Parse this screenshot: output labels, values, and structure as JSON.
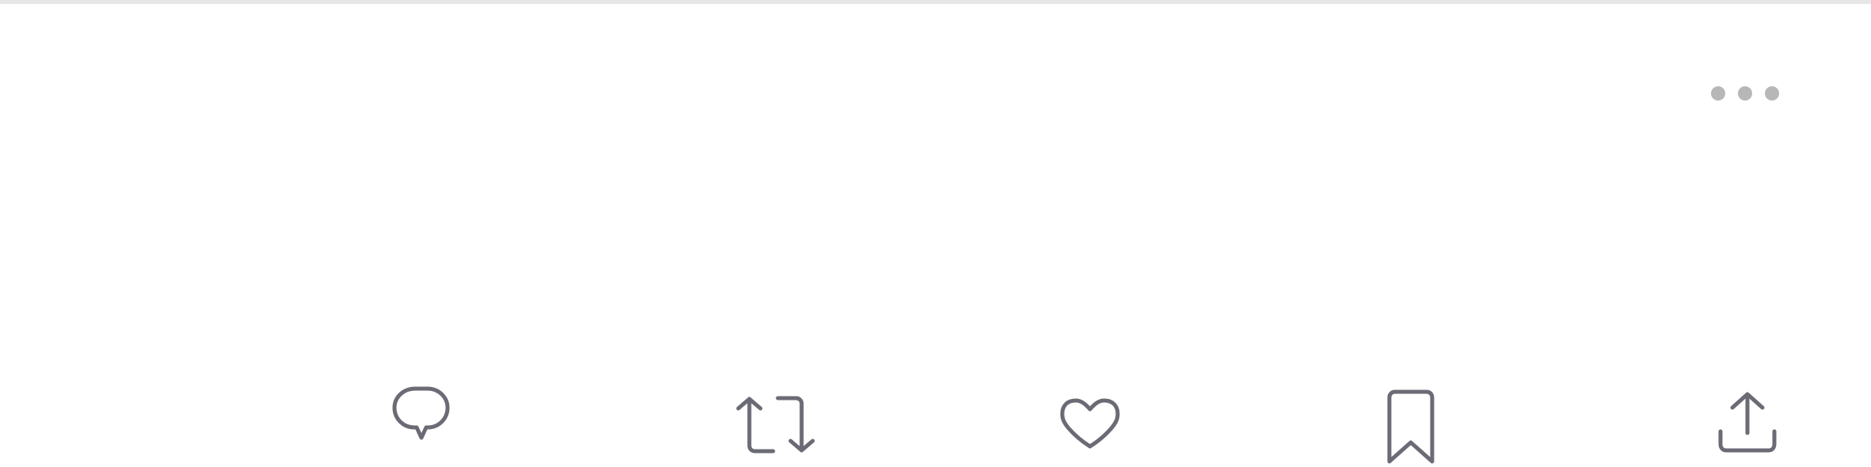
{
  "post_actions": {
    "more_icon": "more-horizontal-icon",
    "icons": {
      "reply": "speech-bubble-icon",
      "repost": "repost-arrows-icon",
      "like": "heart-icon",
      "bookmark": "bookmark-icon",
      "share": "share-upload-icon"
    }
  },
  "colors": {
    "icon": "#6b6b75",
    "more_dots": "#b7b7b7",
    "divider": "#e6e6e6",
    "background": "#ffffff"
  }
}
